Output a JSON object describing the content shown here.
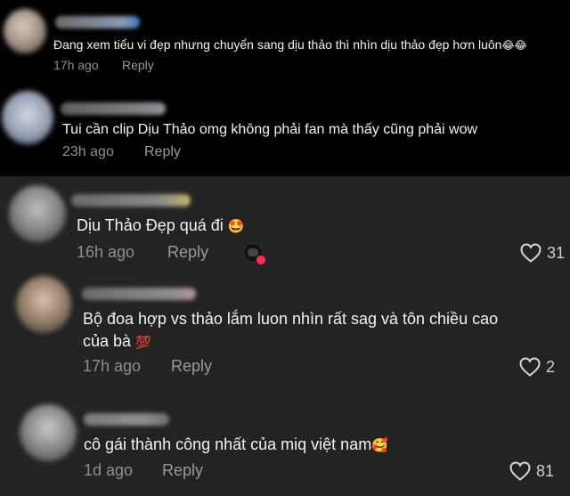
{
  "comments": [
    {
      "text": "Đang xem tiểu vi đẹp nhưng chuyển sang dịu thảo thì nhìn dịu thảo đẹp hơn luôn",
      "emoji": "😂😂",
      "time": "17h ago",
      "reply": "Reply"
    },
    {
      "text": "Tui cần clip Dịu Thảo omg không phải fan mà thấy cũng phải wow",
      "time": "23h ago",
      "reply": "Reply"
    },
    {
      "text": "Dịu Thảo Đẹp quá đi",
      "emoji": "🤩",
      "time": "16h ago",
      "reply": "Reply",
      "likes": "31"
    },
    {
      "text_line1": "Bộ đoa hợp vs thảo lắm luon nhìn rất sag và tôn chiều cao",
      "text_line2": "của bà",
      "emoji": "💯",
      "time": "17h ago",
      "reply": "Reply",
      "likes": "2"
    },
    {
      "text": "cô gái thành công nhất của miq việt nam",
      "emoji": "🥰",
      "time": "1d ago",
      "reply": "Reply",
      "likes": "81"
    }
  ],
  "colors": {
    "background_top": "#000000",
    "background_bottom": "#232323",
    "text": "#f2f2f2",
    "muted": "#8f8f8f"
  }
}
